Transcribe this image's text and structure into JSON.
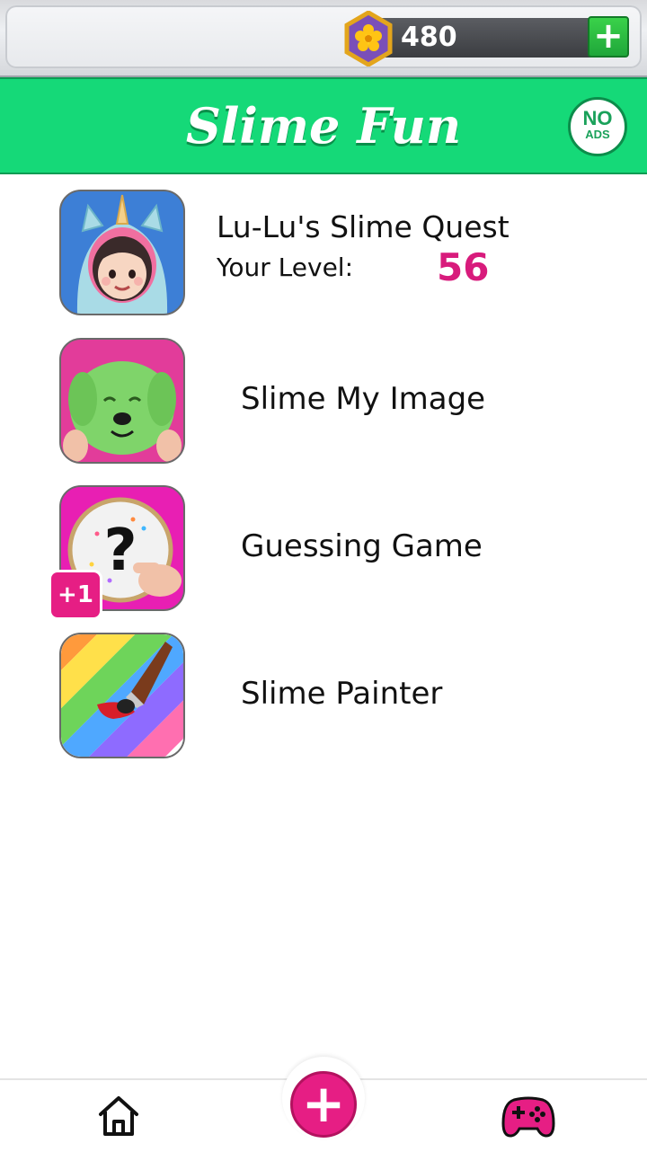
{
  "currency": {
    "amount": "480",
    "add_label": "+"
  },
  "header": {
    "title": "Slime Fun",
    "no_ads_line1": "NO",
    "no_ads_line2": "ADS"
  },
  "items": [
    {
      "title": "Lu-Lu's Slime Quest",
      "level_label": "Your Level:",
      "level_value": "56"
    },
    {
      "title": "Slime My Image"
    },
    {
      "title": "Guessing Game",
      "badge": "+1"
    },
    {
      "title": "Slime Painter"
    }
  ],
  "nav": {
    "fab_label": "+"
  },
  "colors": {
    "header_green": "#15d978",
    "accent_pink": "#e61e84",
    "coin_bar": "#4a4c50"
  }
}
